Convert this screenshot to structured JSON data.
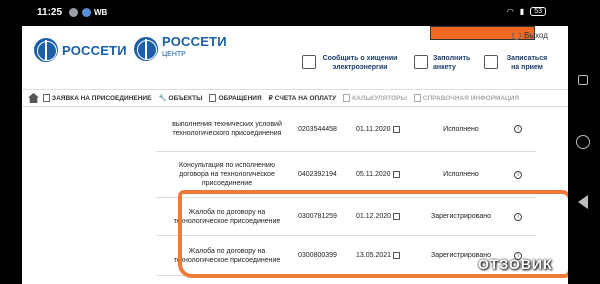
{
  "status_bar": {
    "time": "11:25",
    "carrier": "WB",
    "battery": "53"
  },
  "header": {
    "logo1_text": "РОССЕТИ",
    "logo2_text": "РОССЕТИ",
    "logo2_sub": "ЦЕНТР",
    "logout_label": "Выход",
    "actions": [
      {
        "label": "Сообщить о хищении электроэнергии"
      },
      {
        "label": "Заполнить анкету"
      },
      {
        "label": "Записаться на прием"
      }
    ]
  },
  "nav": {
    "items": [
      {
        "label": "ЗАЯВКА НА ПРИСОЕДИНЕНИЕ"
      },
      {
        "label": "ОБЪЕКТЫ"
      },
      {
        "label": "ОБРАЩЕНИЯ"
      },
      {
        "label": "СЧЕТА НА ОПЛАТУ"
      },
      {
        "label": "КАЛЬКУЛЯТОРЫ"
      },
      {
        "label": "СПРАВОЧНАЯ ИНФОРМАЦИЯ"
      }
    ]
  },
  "table": {
    "rows": [
      {
        "name": "выполнения технических условий технологического присоединения",
        "number": "0203544458",
        "date": "01.11.2020",
        "status": "Исполнено"
      },
      {
        "name": "Консультация по исполнению договора на технологическое присоединение",
        "number": "0402392194",
        "date": "05.11.2020",
        "status": "Исполнено"
      },
      {
        "name": "Жалоба по договору на технологическое присоединение",
        "number": "0300781259",
        "date": "01.12.2020",
        "status": "Зарегистрировано"
      },
      {
        "name": "Жалоба по договору на технологическое присоединение",
        "number": "0300800399",
        "date": "13.05.2021",
        "status": "Зарегистрировано"
      }
    ]
  },
  "watermark": "ОТЗОВИК",
  "colors": {
    "brand": "#1a5fa8",
    "highlight": "#f07a3a"
  }
}
